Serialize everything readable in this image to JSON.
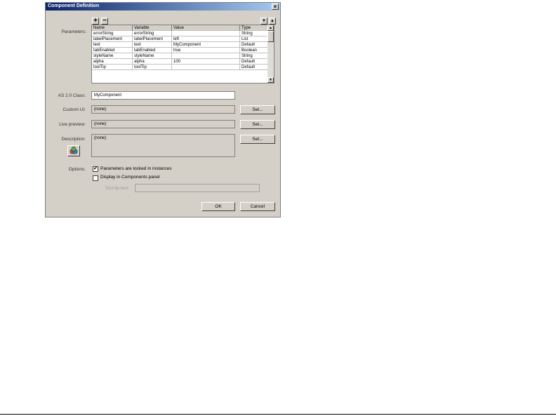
{
  "dialog": {
    "title": "Component Definition",
    "close_glyph": "×"
  },
  "toolbar": {
    "add_glyph": "+",
    "remove_glyph": "−",
    "move_down_glyph": "▼",
    "move_up_glyph": "▲"
  },
  "labels": {
    "parameters": "Parameters:",
    "as_class": "AS 2.0 Class:",
    "custom_ui": "Custom UI:",
    "live_preview": "Live preview:",
    "description": "Description:",
    "options": "Options:",
    "tooltip_text": "Tool tip text:"
  },
  "parameters": {
    "columns": [
      "Name",
      "Variable",
      "Value",
      "Type"
    ],
    "rows": [
      [
        "errorString",
        "errorString",
        "",
        "String"
      ],
      [
        "labelPlacement",
        "labelPlacement",
        "left",
        "List"
      ],
      [
        "text",
        "text",
        "MyComponent",
        "Default"
      ],
      [
        "tabEnabled",
        "tabEnabled",
        "true",
        "Boolean"
      ],
      [
        "styleName",
        "styleName",
        "",
        "String"
      ],
      [
        "alpha",
        "alpha",
        "100",
        "Default"
      ],
      [
        "toolTip",
        "toolTip",
        "",
        "Default"
      ]
    ]
  },
  "fields": {
    "as_class_value": "MyComponent",
    "custom_ui_value": "(none)",
    "live_preview_value": "(none)",
    "description_value": "(none)",
    "tooltip_value": ""
  },
  "buttons": {
    "set_label": "Set...",
    "ok_label": "OK",
    "cancel_label": "Cancel"
  },
  "options": {
    "locked_label": "Parameters are locked in instances",
    "locked_checked": true,
    "display_label": "Display in Components panel",
    "display_checked": false,
    "check_glyph": "✔"
  }
}
